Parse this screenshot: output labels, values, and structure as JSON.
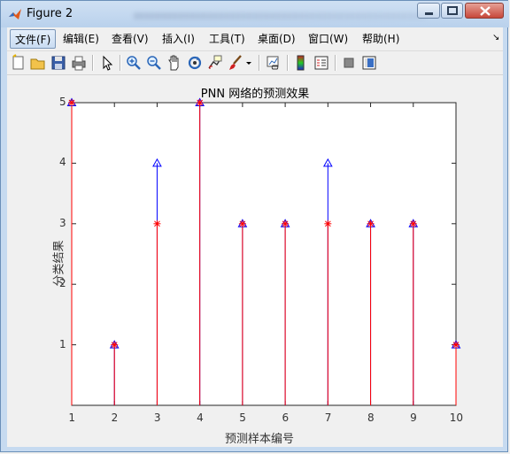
{
  "window": {
    "title": "Figure 2"
  },
  "menu": {
    "items": [
      {
        "label": "文件(F)"
      },
      {
        "label": "编辑(E)"
      },
      {
        "label": "查看(V)"
      },
      {
        "label": "插入(I)"
      },
      {
        "label": "工具(T)"
      },
      {
        "label": "桌面(D)"
      },
      {
        "label": "窗口(W)"
      },
      {
        "label": "帮助(H)"
      }
    ]
  },
  "toolbar": {
    "icons": [
      "new-figure-icon",
      "open-file-icon",
      "save-icon",
      "print-icon",
      "pointer-icon",
      "zoom-in-icon",
      "zoom-out-icon",
      "pan-icon",
      "rotate-3d-icon",
      "data-cursor-icon",
      "brush-icon",
      "link-plot-icon",
      "colorbar-icon",
      "legend-icon",
      "hide-plot-tools-icon",
      "show-plot-tools-icon"
    ]
  },
  "chart_data": {
    "type": "stem",
    "title": "PNN 网络的预测效果",
    "xlabel": "预测样本编号",
    "ylabel": "分类结果",
    "xlim": [
      1,
      10
    ],
    "ylim": [
      0,
      5
    ],
    "xticks": [
      "1",
      "2",
      "3",
      "4",
      "5",
      "6",
      "7",
      "8",
      "9",
      "10"
    ],
    "yticks": [
      "1",
      "2",
      "3",
      "4",
      "5"
    ],
    "x": [
      1,
      2,
      3,
      4,
      5,
      6,
      7,
      8,
      9,
      10
    ],
    "series": [
      {
        "values": [
          5,
          1,
          4,
          5,
          3,
          3,
          4,
          3,
          3,
          1
        ],
        "color": "#0000ff",
        "marker": "triangle"
      },
      {
        "values": [
          5,
          1,
          3,
          5,
          3,
          3,
          3,
          3,
          3,
          1
        ],
        "color": "#ff0000",
        "marker": "star"
      }
    ]
  }
}
